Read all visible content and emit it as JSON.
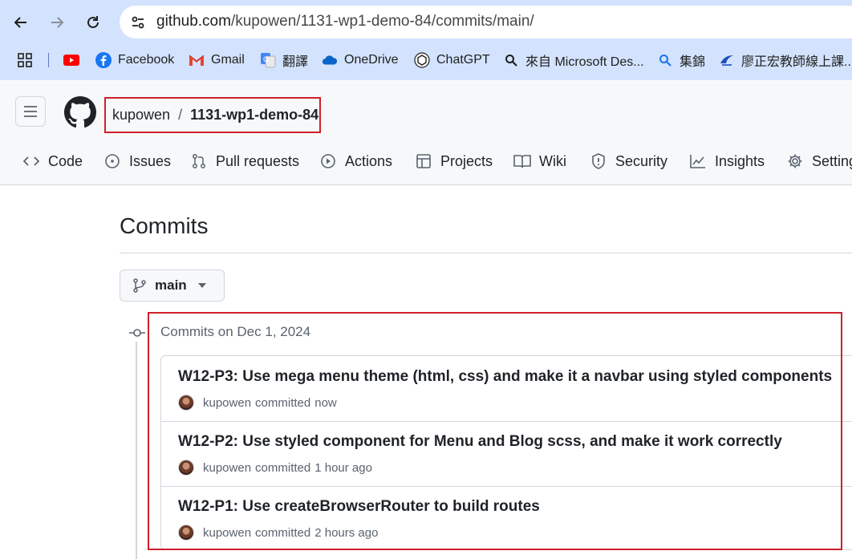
{
  "browser": {
    "url_host": "github.com",
    "url_path": "/kupowen/1131-wp1-demo-84/commits/main/",
    "bookmarks": [
      {
        "label": "",
        "icon": "apps-grid-icon"
      },
      {
        "label": "",
        "icon": "youtube-icon"
      },
      {
        "label": "Facebook",
        "icon": "facebook-icon"
      },
      {
        "label": "Gmail",
        "icon": "gmail-icon"
      },
      {
        "label": "翻譯",
        "icon": "google-translate-icon"
      },
      {
        "label": "OneDrive",
        "icon": "onedrive-icon"
      },
      {
        "label": "ChatGPT",
        "icon": "chatgpt-icon"
      },
      {
        "label": "來自 Microsoft Des...",
        "icon": "search-icon"
      },
      {
        "label": "集錦",
        "icon": "search-icon"
      },
      {
        "label": "廖正宏教師線上課...",
        "icon": "site-icon"
      }
    ]
  },
  "header": {
    "owner": "kupowen",
    "separator": "/",
    "repo": "1131-wp1-demo-84"
  },
  "repo_nav": {
    "tabs": [
      {
        "label": "Code",
        "icon": "code-icon"
      },
      {
        "label": "Issues",
        "icon": "issue-icon"
      },
      {
        "label": "Pull requests",
        "icon": "pull-request-icon"
      },
      {
        "label": "Actions",
        "icon": "play-icon"
      },
      {
        "label": "Projects",
        "icon": "table-icon"
      },
      {
        "label": "Wiki",
        "icon": "book-icon"
      },
      {
        "label": "Security",
        "icon": "shield-icon"
      },
      {
        "label": "Insights",
        "icon": "graph-icon"
      },
      {
        "label": "Setting",
        "icon": "gear-icon"
      }
    ]
  },
  "main": {
    "title": "Commits",
    "branch": "main",
    "group_heading": "Commits on Dec 1, 2024",
    "commits": [
      {
        "title": "W12-P3: Use mega menu theme (html, css) and make it a navbar using styled components",
        "author": "kupowen",
        "action": "committed",
        "time": "now"
      },
      {
        "title": "W12-P2: Use styled component for Menu and Blog scss, and make it work correctly",
        "author": "kupowen",
        "action": "committed",
        "time": "1 hour ago"
      },
      {
        "title": "W12-P1: Use createBrowserRouter to build routes",
        "author": "kupowen",
        "action": "committed",
        "time": "2 hours ago"
      }
    ]
  },
  "colors": {
    "highlight": "#d0202a",
    "chrome_bg": "#d3e3fd",
    "header_bg": "#f6f8fa"
  }
}
